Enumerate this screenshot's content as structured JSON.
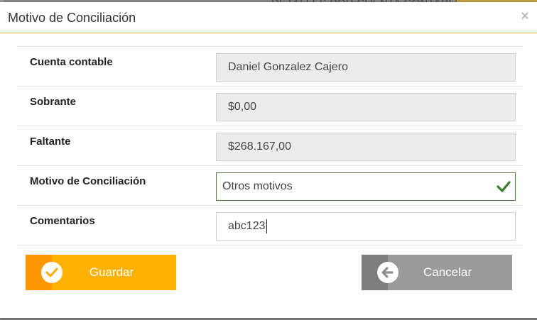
{
  "background": {
    "heading": "DETALLES POR CUENTA CONTABLE"
  },
  "modal": {
    "title": "Motivo de Conciliación",
    "close_label": "×"
  },
  "form": {
    "rows": [
      {
        "label": "Cuenta contable",
        "value": "Daniel Gonzalez Cajero"
      },
      {
        "label": "Sobrante",
        "value": "$0,00"
      },
      {
        "label": "Faltante",
        "value": "$268.167,00"
      },
      {
        "label": "Motivo de Conciliación",
        "value": "Otros motivos"
      },
      {
        "label": "Comentarios",
        "value": "abc123"
      }
    ]
  },
  "buttons": {
    "save_label": "Guardar",
    "cancel_label": "Cancelar"
  },
  "colors": {
    "accent": "#ffb100",
    "accent_dark": "#ff9800",
    "cancel": "#9a9a9a",
    "valid": "#4a7d3c",
    "header_line": "#e7b43a"
  },
  "icons": {
    "close": "close-icon",
    "check": "check-icon",
    "save": "check-circle-icon",
    "cancel": "arrow-left-circle-icon"
  }
}
